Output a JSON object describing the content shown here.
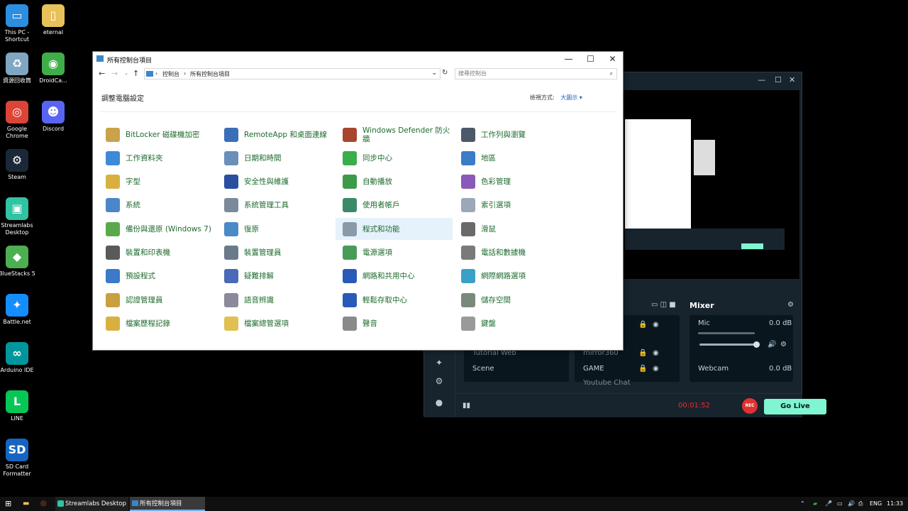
{
  "desktop_icons": [
    {
      "label": "This PC -\nShortcut",
      "color": "#2c8ee0",
      "glyph": "▭"
    },
    {
      "label": "eternal",
      "color": "#e8c15a",
      "glyph": "▯"
    },
    {
      "label": "資源回收筒",
      "color": "#7fa6c2",
      "glyph": "♻"
    },
    {
      "label": "DroidCa...",
      "color": "#3fae49",
      "glyph": "◉"
    },
    {
      "label": "Google\nChrome",
      "color": "#db4437",
      "glyph": "◎"
    },
    {
      "label": "Discord",
      "color": "#5865f2",
      "glyph": "☻"
    },
    {
      "label": "Steam",
      "color": "#1b2838",
      "glyph": "⚙"
    },
    {
      "label": "Streamlabs\nDesktop",
      "color": "#31c3a2",
      "glyph": "▣"
    },
    {
      "label": "BlueStacks 5",
      "color": "#4caf50",
      "glyph": "◆"
    },
    {
      "label": "Battle.net",
      "color": "#148eff",
      "glyph": "✦"
    },
    {
      "label": "Arduino IDE",
      "color": "#00979c",
      "glyph": "∞"
    },
    {
      "label": "LINE",
      "color": "#06c755",
      "glyph": "L"
    },
    {
      "label": "SD Card\nFormatter",
      "color": "#1565c0",
      "glyph": "SD"
    }
  ],
  "control_panel": {
    "title": "所有控制台項目",
    "address": [
      "控制台",
      "所有控制台項目"
    ],
    "search_placeholder": "搜尋控制台",
    "heading": "調整電腦設定",
    "view_by_label": "檢視方式:",
    "view_by_value": "大圖示 ▾",
    "items": [
      {
        "label": "BitLocker 磁碟機加密",
        "color": "#c9a34a"
      },
      {
        "label": "RemoteApp 和桌面連線",
        "color": "#3a6fb8"
      },
      {
        "label": "Windows Defender 防火牆",
        "color": "#a9452e"
      },
      {
        "label": "工作列與瀏覽",
        "color": "#4a5a6a"
      },
      {
        "label": "工作資料夾",
        "color": "#3f8ad8"
      },
      {
        "label": "日期和時間",
        "color": "#6a8fb8"
      },
      {
        "label": "同步中心",
        "color": "#3aae4a"
      },
      {
        "label": "地區",
        "color": "#3a7cc8"
      },
      {
        "label": "字型",
        "color": "#d9b040"
      },
      {
        "label": "安全性與維護",
        "color": "#2a4fa0"
      },
      {
        "label": "自動播放",
        "color": "#3c9a4a"
      },
      {
        "label": "色彩管理",
        "color": "#8a5ab8"
      },
      {
        "label": "系統",
        "color": "#4a86c8"
      },
      {
        "label": "系統管理工具",
        "color": "#7a8a9a"
      },
      {
        "label": "使用者帳戶",
        "color": "#3a8a6a"
      },
      {
        "label": "索引選項",
        "color": "#9aa8b8"
      },
      {
        "label": "備份與還原 (Windows 7)",
        "color": "#5aa84a"
      },
      {
        "label": "復原",
        "color": "#4a8ac8"
      },
      {
        "label": "程式和功能",
        "color": "#8a9aa8"
      },
      {
        "label": "滑鼠",
        "color": "#6a6a6a"
      },
      {
        "label": "裝置和印表機",
        "color": "#5a5a5a"
      },
      {
        "label": "裝置管理員",
        "color": "#6a7a8a"
      },
      {
        "label": "電源選項",
        "color": "#4a9a5a"
      },
      {
        "label": "電話和數據機",
        "color": "#7a7a7a"
      },
      {
        "label": "預設程式",
        "color": "#3a7ac8"
      },
      {
        "label": "疑難排解",
        "color": "#4a6ab8"
      },
      {
        "label": "網路和共用中心",
        "color": "#2a5ab8"
      },
      {
        "label": "網際網路選項",
        "color": "#3aa0c8"
      },
      {
        "label": "認證管理員",
        "color": "#c8a040"
      },
      {
        "label": "語音辨識",
        "color": "#8a8a9a"
      },
      {
        "label": "輕鬆存取中心",
        "color": "#2a5ab8"
      },
      {
        "label": "儲存空間",
        "color": "#7a8a7a"
      },
      {
        "label": "檔案歷程記錄",
        "color": "#d9b040"
      },
      {
        "label": "檔案總管選項",
        "color": "#e0c050"
      },
      {
        "label": "聲音",
        "color": "#8a8a8a"
      },
      {
        "label": "鍵盤",
        "color": "#9a9a9a"
      }
    ]
  },
  "streamlabs": {
    "mixer_title": "Mixer",
    "scenes": [
      "Tutorial Web",
      "Scene"
    ],
    "sources": [
      "mirror360",
      "GAME",
      "Youtube Chat"
    ],
    "mixer": [
      {
        "name": "Mic",
        "value": "0.0 dB"
      },
      {
        "name": "Webcam",
        "value": "0.0 dB"
      }
    ],
    "timer": "00:01:52",
    "rec_label": "REC",
    "go_live": "Go Live"
  },
  "taskbar": {
    "apps": [
      "Streamlabs Desktop",
      "所有控制台項目"
    ],
    "lang": "ENG",
    "time": "11:33"
  }
}
